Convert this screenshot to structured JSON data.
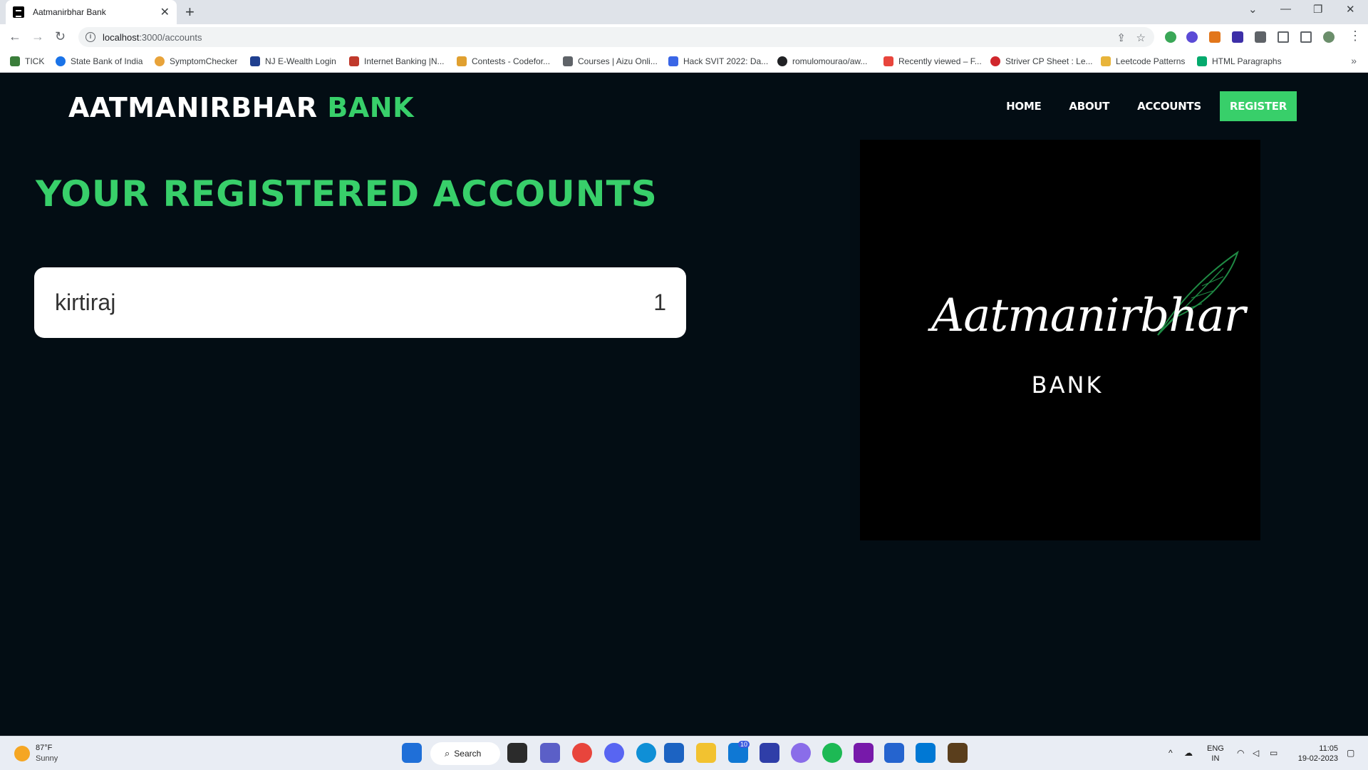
{
  "browser": {
    "tab_title": "Aatmanirbhar Bank",
    "url_host": "localhost",
    "url_path": ":3000/accounts",
    "bookmarks": [
      {
        "label": "TICK",
        "color": "#3a7d3a"
      },
      {
        "label": "State Bank of India",
        "color": "#1a73e8"
      },
      {
        "label": "SymptomChecker",
        "color": "#e8a33a"
      },
      {
        "label": "NJ E-Wealth Login",
        "color": "#1f3f8f"
      },
      {
        "label": "Internet Banking |N...",
        "color": "#c0392b"
      },
      {
        "label": "Contests - Codefor...",
        "color": "#e0a030"
      },
      {
        "label": "Courses | Aizu Onli...",
        "color": "#5f6368"
      },
      {
        "label": "Hack SVIT 2022: Da...",
        "color": "#3a66e6"
      },
      {
        "label": "romulomourao/aw...",
        "color": "#202124"
      },
      {
        "label": "Recently viewed – F...",
        "color": "#e8453c"
      },
      {
        "label": "Striver CP Sheet : Le...",
        "color": "#d0262c"
      },
      {
        "label": "Leetcode Patterns",
        "color": "#e8b43a"
      },
      {
        "label": "HTML Paragraphs",
        "color": "#04aa6d"
      }
    ]
  },
  "site": {
    "brand_main": "AATMANIRBHAR",
    "brand_accent": "BANK",
    "nav": [
      "HOME",
      "ABOUT",
      "ACCOUNTS"
    ],
    "register_label": "REGISTER",
    "heading": "YOUR REGISTERED ACCOUNTS",
    "accounts": [
      {
        "name": "kirtiraj",
        "number": "1"
      }
    ],
    "logo_script": "Aatmanirbhar",
    "logo_word": "BANK",
    "accent_color": "#38cf6a",
    "bg_color": "#030d14"
  },
  "taskbar": {
    "temperature": "87°F",
    "weather": "Sunny",
    "search_label": "Search",
    "mail_badge": "10",
    "lang_top": "ENG",
    "lang_bottom": "IN",
    "time": "11:05",
    "date": "19-02-2023"
  }
}
